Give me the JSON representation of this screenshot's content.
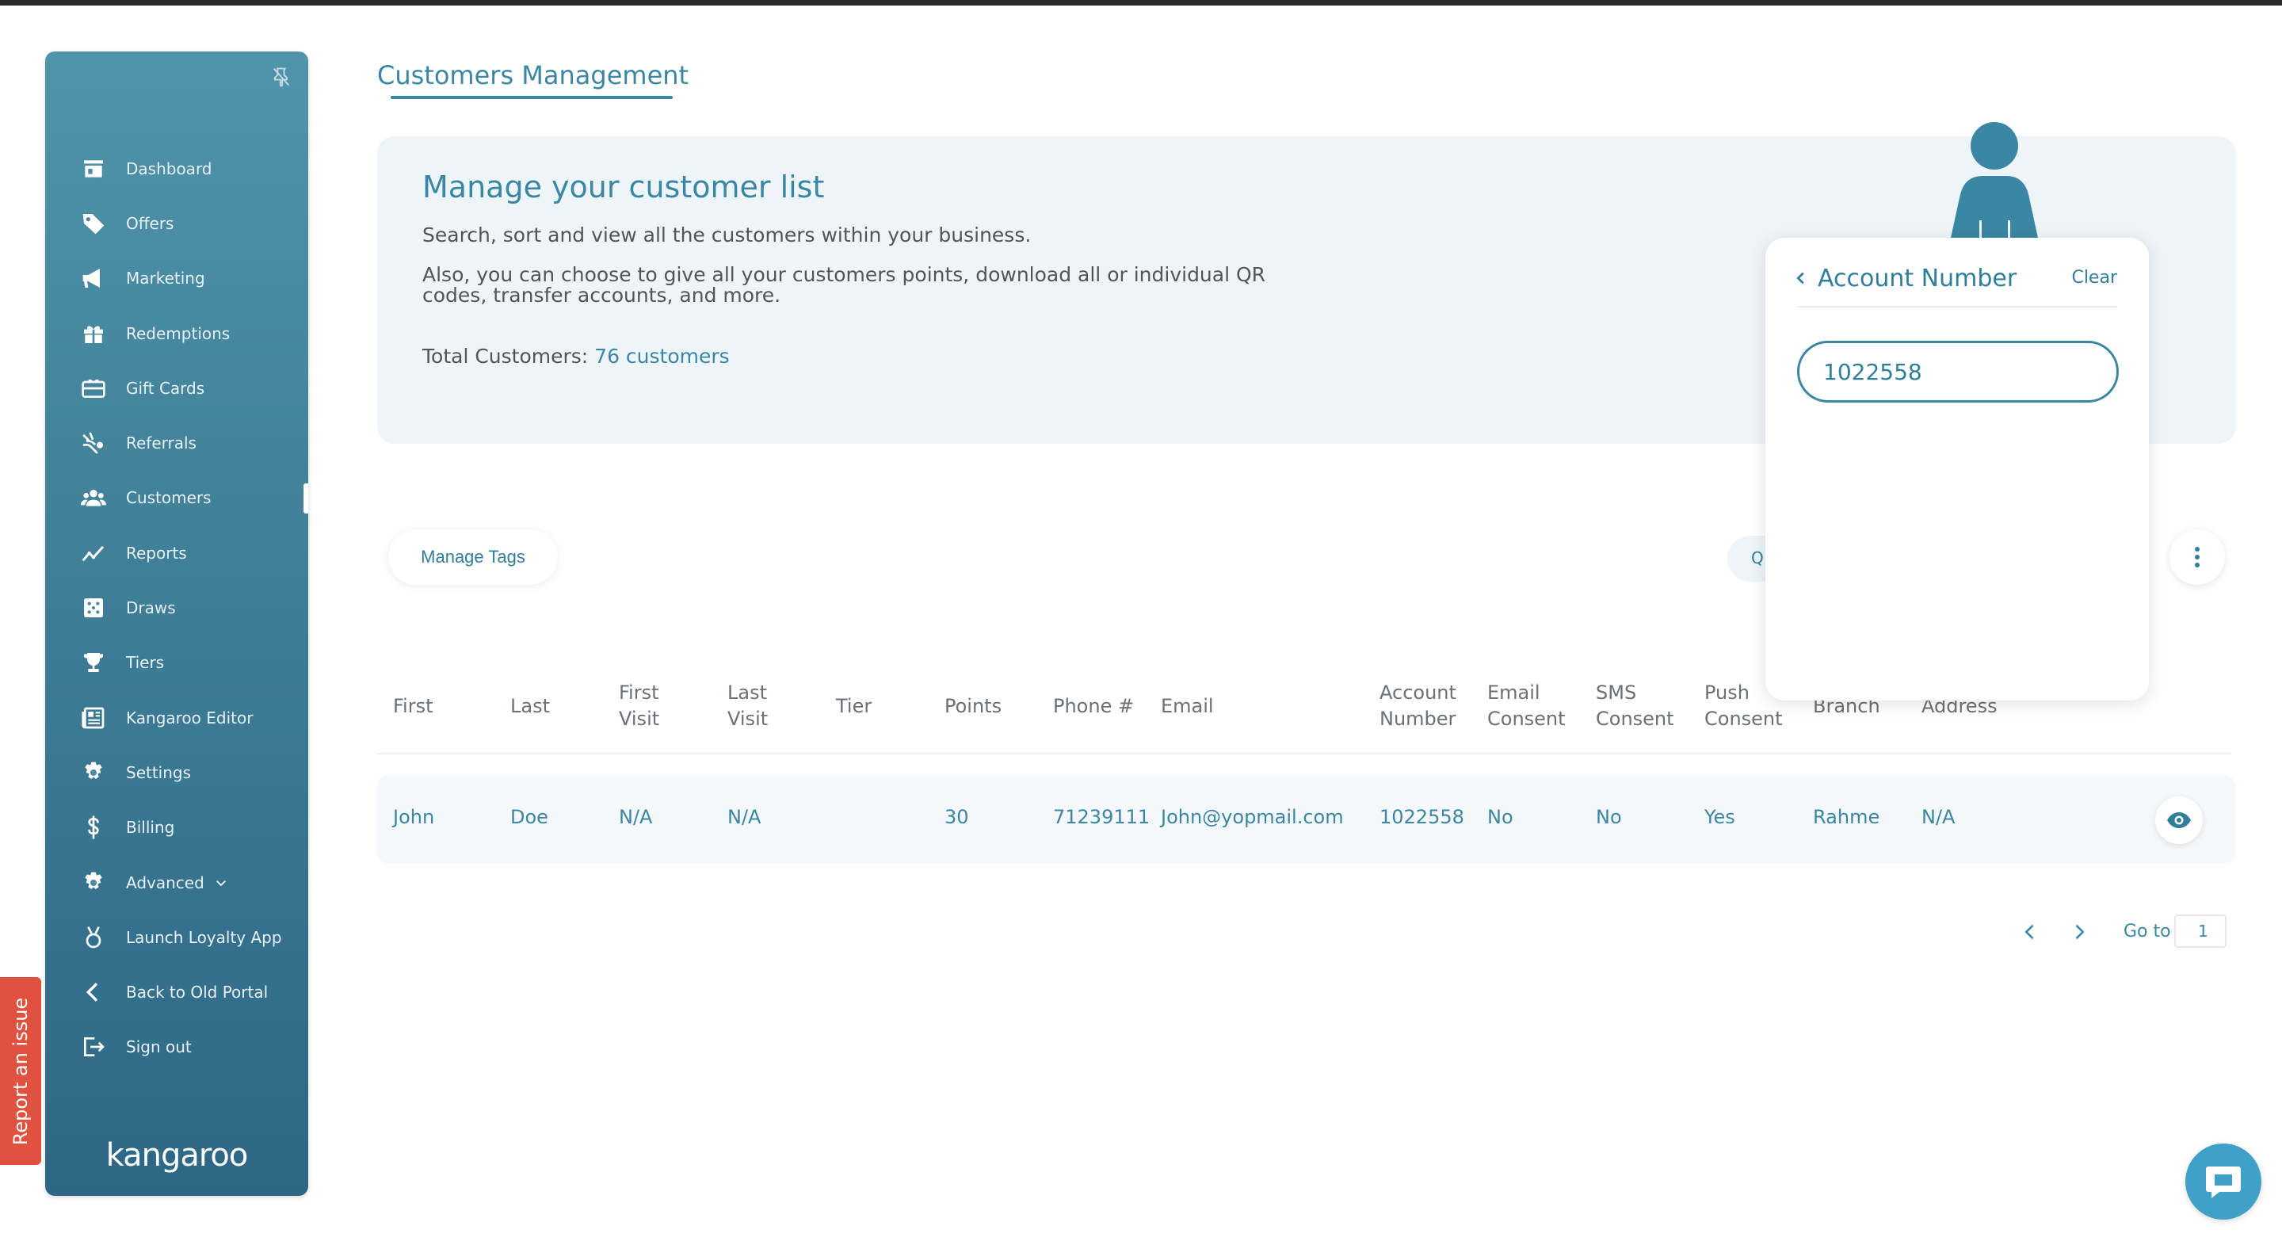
{
  "header": {
    "title": "Customers Management"
  },
  "sidebar": {
    "items": [
      {
        "label": "Dashboard",
        "icon": "store-icon"
      },
      {
        "label": "Offers",
        "icon": "tag-icon"
      },
      {
        "label": "Marketing",
        "icon": "megaphone-icon"
      },
      {
        "label": "Redemptions",
        "icon": "gift-icon"
      },
      {
        "label": "Gift Cards",
        "icon": "gift-card-icon"
      },
      {
        "label": "Referrals",
        "icon": "referral-icon"
      },
      {
        "label": "Customers",
        "icon": "people-icon",
        "active": true
      },
      {
        "label": "Reports",
        "icon": "chart-line-icon"
      },
      {
        "label": "Draws",
        "icon": "dice-icon"
      },
      {
        "label": "Tiers",
        "icon": "trophy-icon"
      },
      {
        "label": "Kangaroo Editor",
        "icon": "newspaper-icon"
      },
      {
        "label": "Settings",
        "icon": "gear-icon"
      },
      {
        "label": "Billing",
        "icon": "dollar-icon"
      },
      {
        "label": "Advanced",
        "icon": "gear-icon"
      },
      {
        "label": "Launch Loyalty App",
        "icon": "medal-icon"
      },
      {
        "label": "Back to Old Portal",
        "icon": "chevron-left-icon"
      },
      {
        "label": "Sign out",
        "icon": "sign-out-icon"
      }
    ],
    "brand": "kangaroo"
  },
  "report_issue": "Report an issue",
  "banner": {
    "title": "Manage your customer list",
    "text1": "Search, sort and view all the customers within your business.",
    "text2": "Also, you can choose to give all your customers points, download all or individual QR codes, transfer accounts, and more.",
    "total_label": "Total Customers:",
    "total_value": "76 customers"
  },
  "toolbar": {
    "manage_tags": "Manage Tags",
    "search_partial": "Q"
  },
  "table": {
    "headers": [
      [
        "First"
      ],
      [
        "Last"
      ],
      [
        "First",
        "Visit"
      ],
      [
        "Last",
        "Visit"
      ],
      [
        "Tier"
      ],
      [
        "Points"
      ],
      [
        "Phone #"
      ],
      [
        "Email"
      ],
      [
        "Account",
        "Number"
      ],
      [
        "Email",
        "Consent"
      ],
      [
        "SMS",
        "Consent"
      ],
      [
        "Push",
        "Consent"
      ],
      [
        "Branch"
      ],
      [
        "Address"
      ]
    ],
    "rows": [
      [
        "John",
        "Doe",
        "N/A",
        "N/A",
        "",
        "30",
        "71239111",
        "John@yopmail.com",
        "1022558",
        "No",
        "No",
        "Yes",
        "Rahme",
        "N/A"
      ]
    ]
  },
  "pagination": {
    "goto_label": "Go to",
    "page": "1"
  },
  "filter_popover": {
    "title": "Account Number",
    "clear": "Clear",
    "value": "1022558"
  },
  "colors": {
    "accent": "#3b87a3",
    "sidebar_top": "#5094ab",
    "sidebar_bottom": "#2e6786",
    "report": "#e0513f",
    "chat": "#3fa0c8"
  }
}
